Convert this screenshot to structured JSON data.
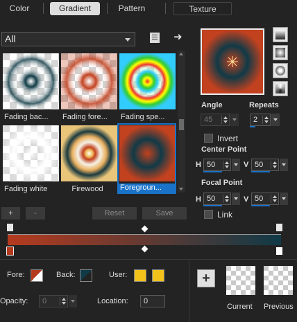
{
  "tabs": {
    "color": "Color",
    "gradient": "Gradient",
    "pattern": "Pattern",
    "texture": "Texture"
  },
  "library": {
    "filter": "All",
    "items": [
      {
        "label": "Fading bac..."
      },
      {
        "label": "Fading fore..."
      },
      {
        "label": "Fading spe..."
      },
      {
        "label": "Fading white"
      },
      {
        "label": "Firewood"
      },
      {
        "label": "Foregroun..."
      }
    ],
    "selected_index": 5,
    "scroll_position": 0.55
  },
  "buttons": {
    "add": "+",
    "remove": "-",
    "reset": "Reset",
    "save": "Save"
  },
  "params": {
    "angle_label": "Angle",
    "angle_value": "45",
    "repeats_label": "Repeats",
    "repeats_value": "2",
    "invert_label": "Invert",
    "center_label": "Center Point",
    "center_h_label": "H",
    "center_h": "50",
    "center_v_label": "V",
    "center_v": "50",
    "focal_label": "Focal Point",
    "focal_h_label": "H",
    "focal_h": "50",
    "focal_v_label": "V",
    "focal_v": "50",
    "link_label": "Link"
  },
  "bottom": {
    "fore_label": "Fore:",
    "back_label": "Back:",
    "user_label": "User:",
    "opacity_label": "Opacity:",
    "opacity_value": "0",
    "location_label": "Location:",
    "location_value": "0",
    "current_label": "Current",
    "previous_label": "Previous",
    "add_swatch_label": "+"
  },
  "colors": {
    "fore": "#b53a1e",
    "back": "#103a47",
    "user1": "#f2c21a",
    "user2": "#f2c21a",
    "accent": "#1a73c9"
  }
}
